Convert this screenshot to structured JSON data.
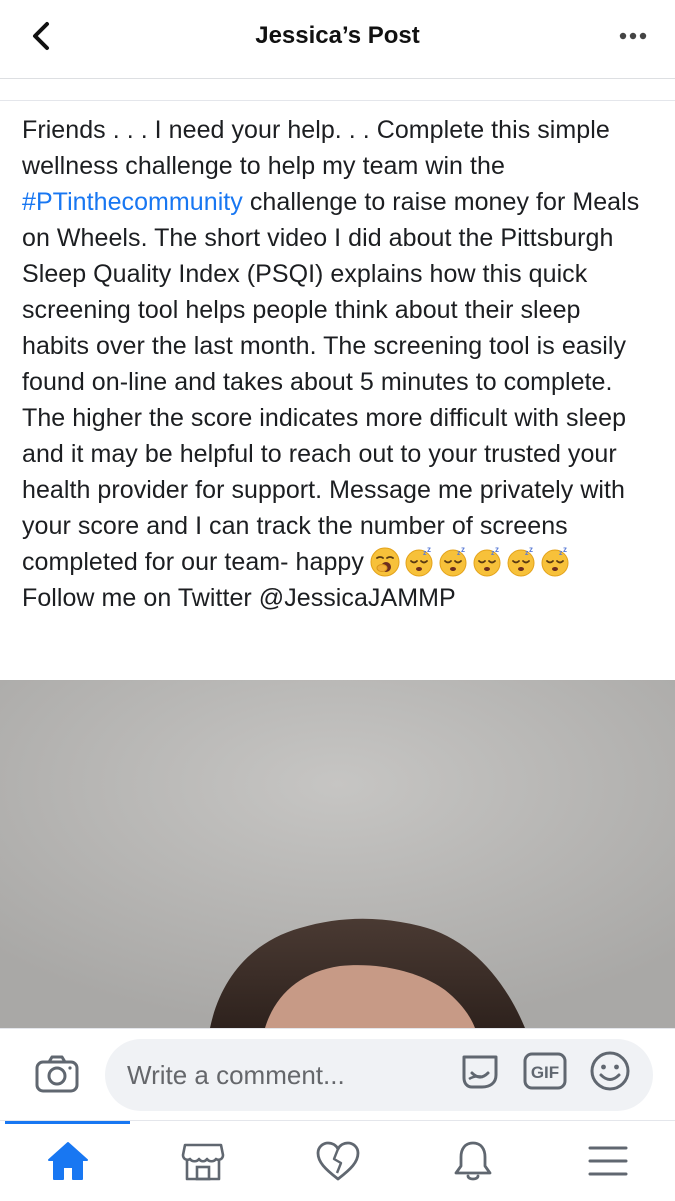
{
  "header": {
    "title": "Jessica’s Post",
    "back_icon": "chevron-left-icon",
    "more_icon": "more-horizontal-icon"
  },
  "post": {
    "text_before_hashtag": "Friends . . . I need your help. . . Complete this simple wellness challenge to help my team win the ",
    "hashtag": "#PTinthecommunity",
    "text_after_hashtag": " challenge to raise money for Meals on Wheels. The short video I did about the Pittsburgh Sleep Quality Index (PSQI) explains how this quick screening tool helps people think about their sleep habits over the last month. The screening tool is easily found on-line and takes about 5 minutes to complete. The higher the score indicates more difficult with sleep and it may be helpful to reach out to your trusted your health provider for support. Message me privately with your score and I can track the number of screens completed for our team- happy",
    "emojis": [
      "yawning-face",
      "sleeping-face",
      "sleeping-face",
      "sleeping-face",
      "sleeping-face",
      "sleeping-face"
    ],
    "closing_line": "Follow me on Twitter @JessicaJAMMP",
    "colors": {
      "hashtag": "#1877f2"
    }
  },
  "comment_bar": {
    "placeholder": "Write a comment...",
    "icons": [
      "camera-icon",
      "sticker-icon",
      "gif-icon",
      "emoji-icon"
    ]
  },
  "tabbar": {
    "tabs": [
      {
        "icon": "home-icon",
        "active": true
      },
      {
        "icon": "marketplace-icon",
        "active": false
      },
      {
        "icon": "heart-icon",
        "active": false
      },
      {
        "icon": "bell-icon",
        "active": false
      },
      {
        "icon": "menu-icon",
        "active": false
      }
    ],
    "accent": "#1877f2"
  }
}
